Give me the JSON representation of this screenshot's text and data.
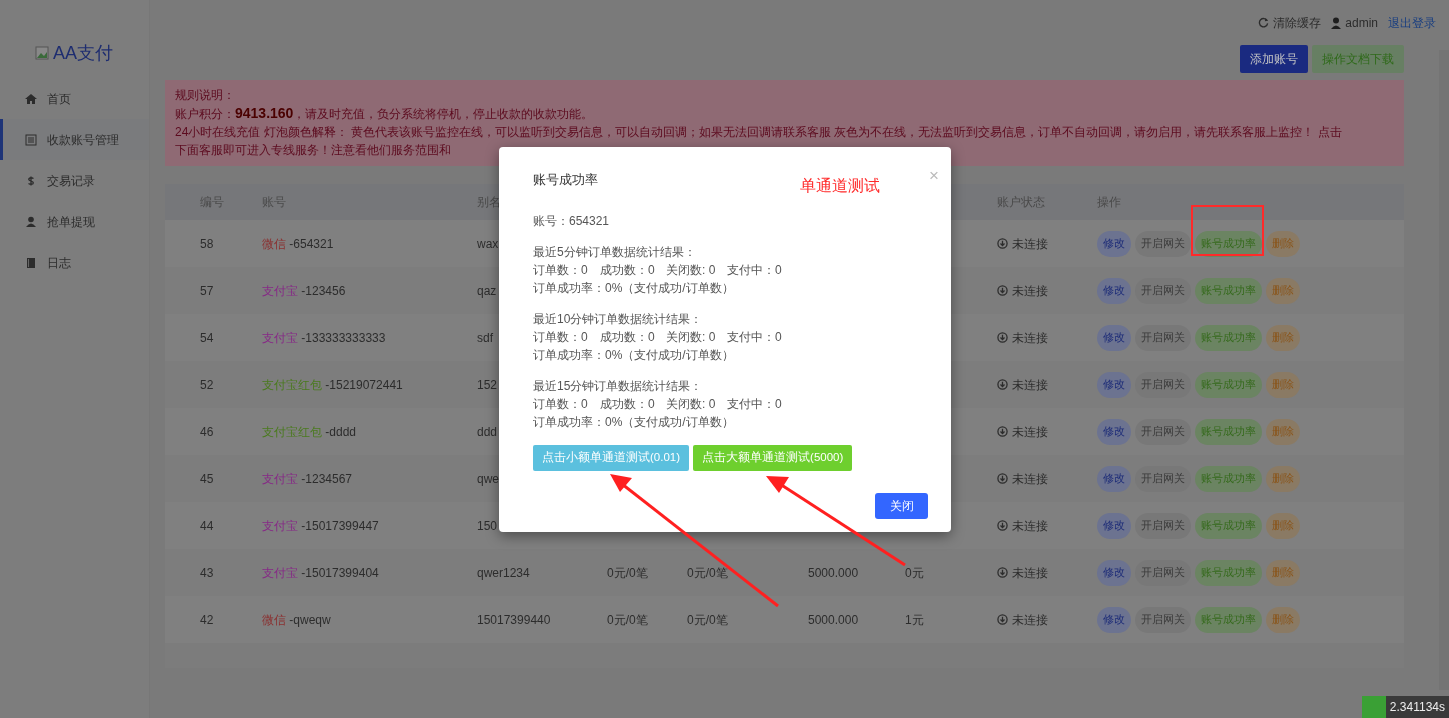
{
  "sidebar": {
    "logo": "AA支付",
    "items": [
      {
        "label": "首页",
        "selected": false
      },
      {
        "label": "收款账号管理",
        "selected": true
      },
      {
        "label": "交易记录",
        "selected": false
      },
      {
        "label": "抢单提现",
        "selected": false
      },
      {
        "label": "日志",
        "selected": false
      }
    ]
  },
  "topbar": {
    "clear_cache": "清除缓存",
    "user": "admin",
    "logout": "退出登录"
  },
  "toolbar": {
    "add_button": "添加账号",
    "doc_button": "操作文档下载"
  },
  "alert": {
    "title": "规则说明：",
    "score_label": "账户积分：",
    "score": "9413.160",
    "score_note": "，请及时充值，负分系统将停机，停止收款的收款功能。",
    "line_3": "24小时在线充值 灯泡颜色解释： 黄色代表该账号监控在线，可以监听到交易信息，可以自动回调；如果无法回调请联系客服 灰色为不在线，无法监听到交易信息，订单不自动回调，请勿启用，请先联系客服上监控！ 点击",
    "line_4": "下面客服即可进入专线服务！注意看他们服务范围和"
  },
  "table": {
    "columns": [
      {
        "label": "编号"
      },
      {
        "label": "账号"
      },
      {
        "label": "别名"
      },
      {},
      {},
      {},
      {},
      {
        "label": "账户状态"
      },
      {
        "label": "操作"
      }
    ],
    "rows": [
      {
        "id": "58",
        "type": "微信",
        "color": "#8a3030",
        "account": "-654321",
        "alias": "wax",
        "status": "未连接",
        "actions": [
          "修改",
          "开启网关",
          "账号成功率",
          "删除"
        ]
      },
      {
        "id": "57",
        "type": "支付宝",
        "color": "#862a86",
        "account": "-123456",
        "alias": "qaz",
        "status": "未连接",
        "actions": [
          "修改",
          "开启网关",
          "账号成功率",
          "删除"
        ]
      },
      {
        "id": "54",
        "type": "支付宝",
        "color": "#862a86",
        "account": "-133333333333",
        "alias": "sdf",
        "status": "未连接",
        "actions": [
          "修改",
          "开启网关",
          "账号成功率",
          "删除"
        ]
      },
      {
        "id": "52",
        "type": "支付宝红包",
        "color": "#4a7a1e",
        "account": "-15219072441",
        "alias": "152",
        "status": "未连接",
        "actions": [
          "修改",
          "开启网关",
          "账号成功率",
          "删除"
        ]
      },
      {
        "id": "46",
        "type": "支付宝红包",
        "color": "#4a7a1e",
        "account": "-dddd",
        "alias": "ddd",
        "status": "未连接",
        "actions": [
          "修改",
          "开启网关",
          "账号成功率",
          "删除"
        ]
      },
      {
        "id": "45",
        "type": "支付宝",
        "color": "#862a86",
        "account": "-1234567",
        "alias": "qwe",
        "status": "未连接",
        "actions": [
          "修改",
          "开启网关",
          "账号成功率",
          "删除"
        ]
      },
      {
        "id": "44",
        "type": "支付宝",
        "color": "#862a86",
        "account": "-15017399447",
        "alias": "150",
        "status": "未连接",
        "actions": [
          "修改",
          "开启网关",
          "账号成功率",
          "删除"
        ]
      },
      {
        "id": "43",
        "type": "支付宝",
        "color": "#862a86",
        "account": "-15017399404",
        "alias": "qwer1234",
        "column_4": "0元/0笔",
        "column_5": "0元/0笔",
        "column_6": "5000.000",
        "column_7": "0元",
        "status": "未连接",
        "actions": [
          "修改",
          "开启网关",
          "账号成功率",
          "删除"
        ]
      },
      {
        "id": "42",
        "type": "微信",
        "color": "#8a3030",
        "account": "-qweqw",
        "alias": "15017399440",
        "column_4": "0元/0笔",
        "column_5": "0元/0笔",
        "column_6": "5000.000",
        "column_7": "1元",
        "status": "未连接",
        "actions": [
          "修改",
          "开启网关",
          "账号成功率",
          "删除"
        ]
      }
    ]
  },
  "modal": {
    "title": "账号成功率",
    "close_icon": "×",
    "account": "账号：654321",
    "stats": [
      {
        "heading": "最近5分钟订单数据统计结果：",
        "orders": "订单数：0",
        "success": "成功数：0",
        "closed": "关闭数: 0",
        "paying": "支付中：0",
        "rate": "订单成功率：0%（支付成功/订单数）"
      },
      {
        "heading": "最近10分钟订单数据统计结果：",
        "orders": "订单数：0",
        "success": "成功数：0",
        "closed": "关闭数: 0",
        "paying": "支付中：0",
        "rate": "订单成功率：0%（支付成功/订单数）"
      },
      {
        "heading": "最近15分钟订单数据统计结果：",
        "orders": "订单数：0",
        "success": "成功数：0",
        "closed": "关闭数: 0",
        "paying": "支付中：0",
        "rate": "订单成功率：0%（支付成功/订单数）"
      }
    ],
    "small_test_button": "点击小额单通道测试(0.01)",
    "large_test_button": "点击大额单通道测试(5000)",
    "close_button": "关闭"
  },
  "annotation": {
    "label": "单通道测试"
  },
  "timer": "2.341134s"
}
